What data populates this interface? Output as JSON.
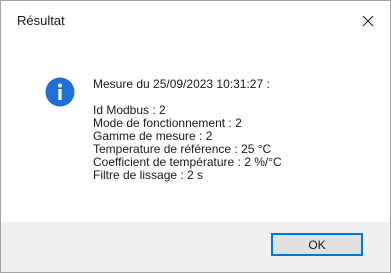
{
  "window": {
    "title": "Résultat",
    "close_icon": "close-icon"
  },
  "message": {
    "icon": "info-icon",
    "heading": "Mesure du 25/09/2023 10:31:27 :",
    "lines": [
      "Id Modbus : 2",
      "Mode de fonctionnement : 2",
      "Gamme de mesure : 2",
      "Temperature de référence : 25 °C",
      "Coefficient de température : 2 %/°C",
      "Filtre de lissage : 2 s"
    ]
  },
  "buttons": {
    "ok_label": "OK"
  },
  "colors": {
    "info_blue": "#1e6fd9",
    "button_focus_border": "#0078d7",
    "footer_bg": "#f0f0f0"
  }
}
